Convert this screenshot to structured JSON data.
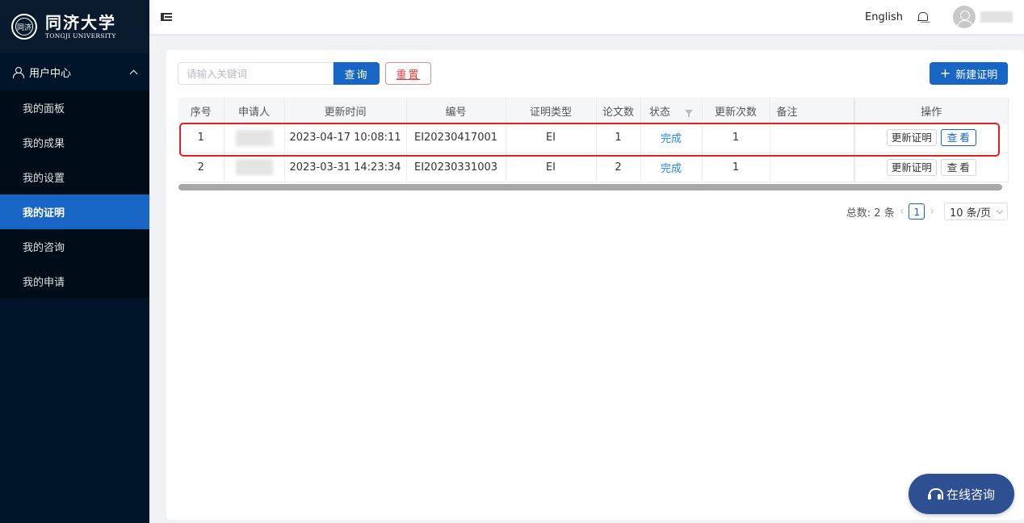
{
  "sidebar": {
    "logo": {
      "cn": "同济大学",
      "en": "TONGJI UNIVERSITY",
      "seal_text": "同济"
    },
    "group_label": "用户中心",
    "items": [
      {
        "label": "我的面板",
        "active": false
      },
      {
        "label": "我的成果",
        "active": false
      },
      {
        "label": "我的设置",
        "active": false
      },
      {
        "label": "我的证明",
        "active": true
      },
      {
        "label": "我的咨询",
        "active": false
      },
      {
        "label": "我的申请",
        "active": false
      }
    ]
  },
  "header": {
    "language": "English",
    "icons": [
      "menu-fold-icon",
      "bell-icon",
      "avatar-icon"
    ]
  },
  "toolbar": {
    "search_placeholder": "请输入关键词",
    "search_value": "",
    "search_label": "查询",
    "reset_label": "重置",
    "new_label": "新建证明"
  },
  "table": {
    "columns": [
      "序号",
      "申请人",
      "更新时间",
      "编号",
      "证明类型",
      "论文数",
      "状态",
      "更新次数",
      "备注",
      "操作"
    ],
    "rows": [
      {
        "index": "1",
        "applicant": "",
        "updated": "2023-04-17 10:08:11",
        "number": "EI20230417001",
        "type": "EI",
        "papers": "1",
        "status": "完成",
        "update_count": "1",
        "remark": "",
        "update_btn": "更新证明",
        "view_btn": "查看",
        "highlighted": true
      },
      {
        "index": "2",
        "applicant": "",
        "updated": "2023-03-31 14:23:34",
        "number": "EI20230331003",
        "type": "EI",
        "papers": "2",
        "status": "完成",
        "update_count": "1",
        "remark": "",
        "update_btn": "更新证明",
        "view_btn": "查看",
        "highlighted": false
      }
    ]
  },
  "pagination": {
    "total_text": "总数: 2 条",
    "current_page": "1",
    "page_size": "10 条/页"
  },
  "consult": {
    "label": "在线咨询"
  },
  "colors": {
    "primary": "#1765c4",
    "sidebar_bg": "#001529",
    "danger": "#e02020",
    "status": "#1e88e5"
  }
}
